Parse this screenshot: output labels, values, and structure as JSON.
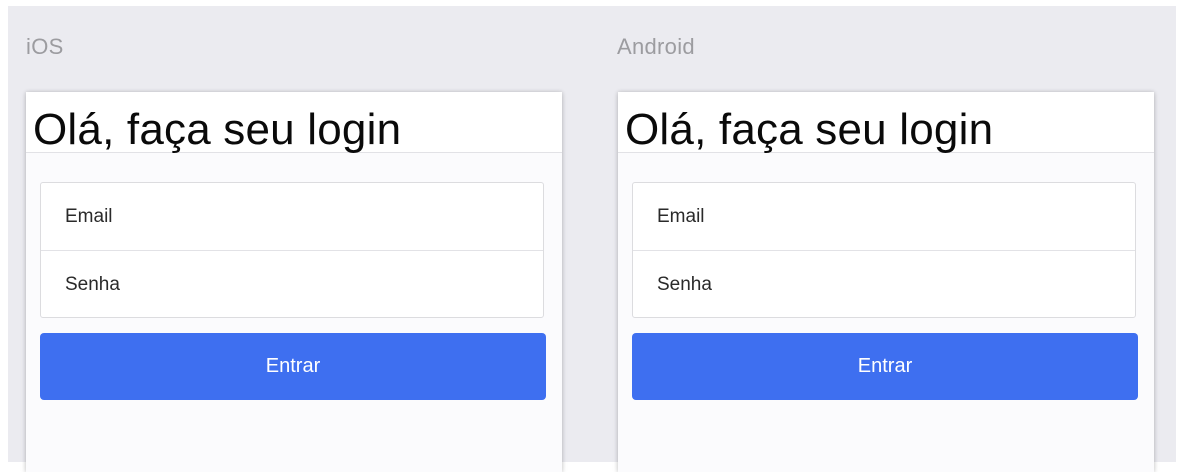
{
  "platforms": [
    {
      "label": "iOS",
      "title": "Olá, faça seu login",
      "email_placeholder": "Email",
      "password_placeholder": "Senha",
      "submit_label": "Entrar"
    },
    {
      "label": "Android",
      "title": "Olá, faça seu login",
      "email_placeholder": "Email",
      "password_placeholder": "Senha",
      "submit_label": "Entrar"
    }
  ],
  "colors": {
    "background": "#ebebf0",
    "button": "#3e6ff0",
    "button_text": "#ffffff",
    "label_text": "#9c9ca0"
  }
}
